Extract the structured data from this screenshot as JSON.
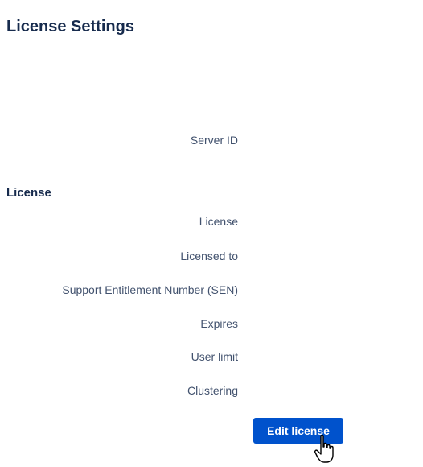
{
  "page": {
    "title": "License Settings"
  },
  "server": {
    "server_id_label": "Server ID"
  },
  "license_section": {
    "heading": "License",
    "fields": [
      "License",
      "Licensed to",
      "Support Entitlement Number (SEN)",
      "Expires",
      "User limit",
      "Clustering"
    ],
    "edit_button_label": "Edit license"
  },
  "colors": {
    "accent": "#0052cc",
    "text_primary": "#172b4d",
    "text_secondary": "#42526e"
  },
  "icons": {
    "cursor": "hand-pointer-icon"
  }
}
